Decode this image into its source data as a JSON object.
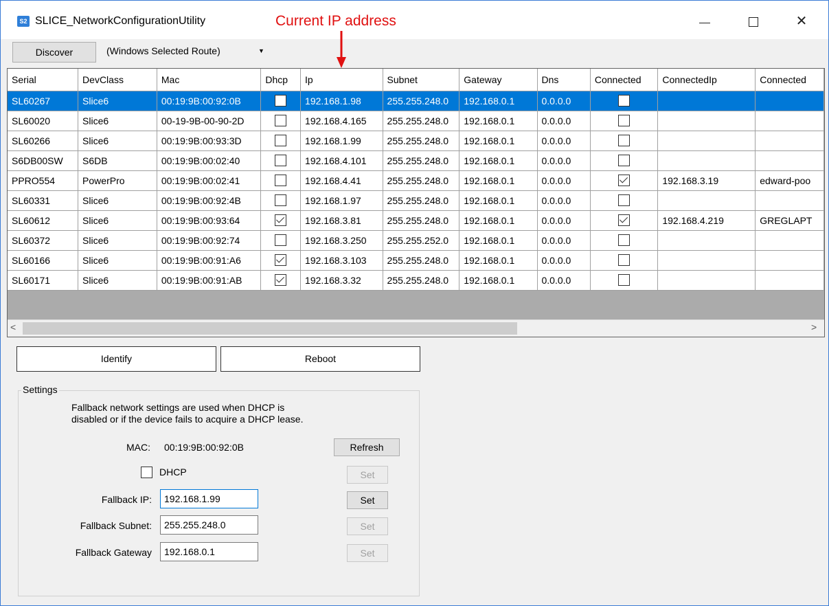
{
  "window": {
    "icon_text": "S2",
    "title": "SLICE_NetworkConfigurationUtility",
    "minimize_symbol": "—",
    "maximize_symbol": "☐",
    "close_symbol": "✕"
  },
  "annotation": {
    "text": "Current IP address",
    "color": "#e01010"
  },
  "toolbar": {
    "discover_label": "Discover",
    "route_value": "(Windows Selected Route)",
    "route_arrow": "▼"
  },
  "grid": {
    "columns": [
      "Serial",
      "DevClass",
      "Mac",
      "Dhcp",
      "Ip",
      "Subnet",
      "Gateway",
      "Dns",
      "Connected",
      "ConnectedIp",
      "Connected"
    ],
    "selected_color": "#0078d7",
    "rows": [
      {
        "serial": "SL60267",
        "devclass": "Slice6",
        "mac": "00:19:9B:00:92:0B",
        "dhcp": false,
        "ip": "192.168.1.98",
        "subnet": "255.255.248.0",
        "gateway": "192.168.0.1",
        "dns": "0.0.0.0",
        "connected": false,
        "connected_ip": "",
        "connected_name": "",
        "selected": true
      },
      {
        "serial": "SL60020",
        "devclass": "Slice6",
        "mac": "00-19-9B-00-90-2D",
        "dhcp": false,
        "ip": "192.168.4.165",
        "subnet": "255.255.248.0",
        "gateway": "192.168.0.1",
        "dns": "0.0.0.0",
        "connected": false,
        "connected_ip": "",
        "connected_name": ""
      },
      {
        "serial": "SL60266",
        "devclass": "Slice6",
        "mac": "00:19:9B:00:93:3D",
        "dhcp": false,
        "ip": "192.168.1.99",
        "subnet": "255.255.248.0",
        "gateway": "192.168.0.1",
        "dns": "0.0.0.0",
        "connected": false,
        "connected_ip": "",
        "connected_name": ""
      },
      {
        "serial": "S6DB00SW",
        "devclass": "S6DB",
        "mac": "00:19:9B:00:02:40",
        "dhcp": false,
        "ip": "192.168.4.101",
        "subnet": "255.255.248.0",
        "gateway": "192.168.0.1",
        "dns": "0.0.0.0",
        "connected": false,
        "connected_ip": "",
        "connected_name": ""
      },
      {
        "serial": "PPRO554",
        "devclass": "PowerPro",
        "mac": "00:19:9B:00:02:41",
        "dhcp": false,
        "ip": "192.168.4.41",
        "subnet": "255.255.248.0",
        "gateway": "192.168.0.1",
        "dns": "0.0.0.0",
        "connected": true,
        "connected_ip": "192.168.3.19",
        "connected_name": "edward-poo"
      },
      {
        "serial": "SL60331",
        "devclass": "Slice6",
        "mac": "00:19:9B:00:92:4B",
        "dhcp": false,
        "ip": "192.168.1.97",
        "subnet": "255.255.248.0",
        "gateway": "192.168.0.1",
        "dns": "0.0.0.0",
        "connected": false,
        "connected_ip": "",
        "connected_name": ""
      },
      {
        "serial": "SL60612",
        "devclass": "Slice6",
        "mac": "00:19:9B:00:93:64",
        "dhcp": true,
        "ip": "192.168.3.81",
        "subnet": "255.255.248.0",
        "gateway": "192.168.0.1",
        "dns": "0.0.0.0",
        "connected": true,
        "connected_ip": "192.168.4.219",
        "connected_name": "GREGLAPT"
      },
      {
        "serial": "SL60372",
        "devclass": "Slice6",
        "mac": "00:19:9B:00:92:74",
        "dhcp": false,
        "ip": "192.168.3.250",
        "subnet": "255.255.252.0",
        "gateway": "192.168.0.1",
        "dns": "0.0.0.0",
        "connected": false,
        "connected_ip": "",
        "connected_name": ""
      },
      {
        "serial": "SL60166",
        "devclass": "Slice6",
        "mac": "00:19:9B:00:91:A6",
        "dhcp": true,
        "ip": "192.168.3.103",
        "subnet": "255.255.248.0",
        "gateway": "192.168.0.1",
        "dns": "0.0.0.0",
        "connected": false,
        "connected_ip": "",
        "connected_name": ""
      },
      {
        "serial": "SL60171",
        "devclass": "Slice6",
        "mac": "00:19:9B:00:91:AB",
        "dhcp": true,
        "ip": "192.168.3.32",
        "subnet": "255.255.248.0",
        "gateway": "192.168.0.1",
        "dns": "0.0.0.0",
        "connected": false,
        "connected_ip": "",
        "connected_name": ""
      }
    ],
    "scroll_left_symbol": "<",
    "scroll_right_symbol": ">"
  },
  "actions": {
    "identify_label": "Identify",
    "reboot_label": "Reboot"
  },
  "settings": {
    "group_label": "Settings",
    "description_line1": "Fallback network settings are used when DHCP is",
    "description_line2": "disabled or if the device fails to acquire a DHCP lease.",
    "mac_label": "MAC:",
    "mac_value": "00:19:9B:00:92:0B",
    "refresh_label": "Refresh",
    "dhcp_label": "DHCP",
    "dhcp_checked": false,
    "fallback_ip_label": "Fallback IP:",
    "fallback_ip_value": "192.168.1.99",
    "fallback_subnet_label": "Fallback Subnet:",
    "fallback_subnet_value": "255.255.248.0",
    "fallback_gateway_label": "Fallback Gateway",
    "fallback_gateway_value": "192.168.0.1",
    "set_label": "Set"
  }
}
